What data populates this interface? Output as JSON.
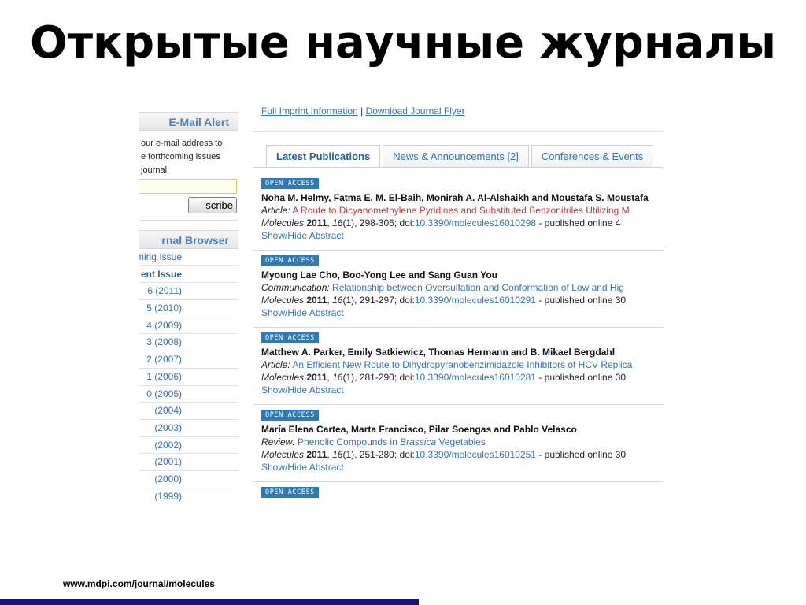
{
  "slide": {
    "title": "Открытые научные журналы",
    "footer_url": "www.mdpi.com/journal/molecules"
  },
  "sidebar": {
    "email_alert": {
      "heading": "E-Mail Alert",
      "text_lines": [
        "our e-mail address to",
        "e forthcoming issues",
        "journal:"
      ],
      "subscribe_label": "scribe"
    },
    "browser": {
      "heading": "rnal Browser",
      "items": [
        {
          "label": "coming Issue",
          "bold": false
        },
        {
          "label": "ent Issue",
          "bold": true
        },
        {
          "label": "6 (2011)",
          "bold": false
        },
        {
          "label": "5 (2010)",
          "bold": false
        },
        {
          "label": "4 (2009)",
          "bold": false
        },
        {
          "label": "3 (2008)",
          "bold": false
        },
        {
          "label": "2 (2007)",
          "bold": false
        },
        {
          "label": "1 (2006)",
          "bold": false
        },
        {
          "label": "0 (2005)",
          "bold": false
        },
        {
          "label": "(2004)",
          "bold": false
        },
        {
          "label": "(2003)",
          "bold": false
        },
        {
          "label": "(2002)",
          "bold": false
        },
        {
          "label": "(2001)",
          "bold": false
        },
        {
          "label": "(2000)",
          "bold": false
        },
        {
          "label": "(1999)",
          "bold": false
        }
      ]
    }
  },
  "header": {
    "imprint_link": "Full Imprint Information",
    "separator": "|",
    "flyer_link": "Download Journal Flyer"
  },
  "tabs": [
    {
      "label": "Latest Publications",
      "active": true
    },
    {
      "label": "News & Announcements [2]",
      "active": false
    },
    {
      "label": "Conferences & Events",
      "active": false
    }
  ],
  "publications": [
    {
      "badge": "OPEN ACCESS",
      "authors": "Noha M. Helmy, Fatma E. M. El-Baih, Monirah A. Al-Alshaikh and Moustafa S. Moustafa",
      "type": "Article:",
      "title": "A Route to Dicyanomethylene Pyridines and Substituted Benzonitriles Utilizing M",
      "title_color": "#c23a3a",
      "journal": "Molecules",
      "year": "2011",
      "volume": "16",
      "issue": "(1)",
      "pages": ", 298-306; doi:",
      "doi": "10.3390/molecules16010298",
      "published": " - published online 4",
      "toggle": "Show/Hide Abstract"
    },
    {
      "badge": "OPEN ACCESS",
      "authors": "Myoung Lae Cho, Boo-Yong Lee and Sang Guan You",
      "type": "Communication:",
      "title": "Relationship between Oversulfation and Conformation of Low and Hig",
      "title_color": "#3573b4",
      "journal": "Molecules",
      "year": "2011",
      "volume": "16",
      "issue": "(1)",
      "pages": ", 291-297; doi:",
      "doi": "10.3390/molecules16010291",
      "published": " - published online 30",
      "toggle": "Show/Hide Abstract"
    },
    {
      "badge": "OPEN ACCESS",
      "authors": "Matthew A. Parker, Emily Satkiewicz, Thomas Hermann and B. Mikael Bergdahl",
      "type": "Article:",
      "title": "An Efficient New Route to Dihydropyranobenzimidazole Inhibitors of HCV Replica",
      "title_color": "#3573b4",
      "journal": "Molecules",
      "year": "2011",
      "volume": "16",
      "issue": "(1)",
      "pages": ", 281-290; doi:",
      "doi": "10.3390/molecules16010281",
      "published": " - published online 30",
      "toggle": "Show/Hide Abstract"
    },
    {
      "badge": "OPEN ACCESS",
      "authors": "María Elena Cartea, Marta Francisco, Pilar Soengas and Pablo Velasco",
      "type": "Review:",
      "title_pre": "Phenolic Compounds in ",
      "title_it": "Brassica",
      "title_post": " Vegetables",
      "title_color": "#3573b4",
      "journal": "Molecules",
      "year": "2011",
      "volume": "16",
      "issue": "(1)",
      "pages": ", 251-280; doi:",
      "doi": "10.3390/molecules16010251",
      "published": " - published online 30",
      "toggle": "Show/Hide Abstract"
    }
  ],
  "partial_item": {
    "badge": "OPEN ACCESS"
  },
  "colors": {
    "link": "#3573b4",
    "badge": "#2d7ab6",
    "footer_bar": "#13138e"
  }
}
